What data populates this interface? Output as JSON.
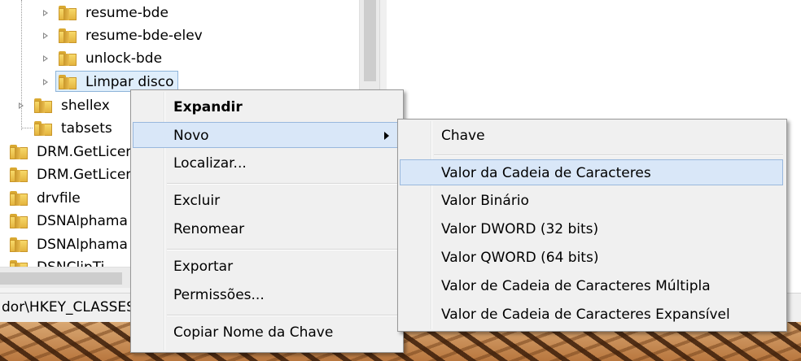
{
  "tree": {
    "items": [
      {
        "label": "resume-bde"
      },
      {
        "label": "resume-bde-elev"
      },
      {
        "label": "unlock-bde"
      },
      {
        "label": "Limpar disco"
      },
      {
        "label": "shellex"
      },
      {
        "label": "tabsets"
      },
      {
        "label": "DRM.GetLicen"
      },
      {
        "label": "DRM.GetLicen"
      },
      {
        "label": "drvfile"
      },
      {
        "label": "DSNAlphama"
      },
      {
        "label": "DSNAlphama"
      },
      {
        "label": "DSNClipTi"
      }
    ]
  },
  "statusbar": {
    "path": "dor\\HKEY_CLASSES"
  },
  "context_menu": {
    "items": [
      {
        "label": "Expandir"
      },
      {
        "label": "Novo"
      },
      {
        "label": "Localizar..."
      },
      {
        "label": "Excluir"
      },
      {
        "label": "Renomear"
      },
      {
        "label": "Exportar"
      },
      {
        "label": "Permissões..."
      },
      {
        "label": "Copiar Nome da Chave"
      }
    ]
  },
  "submenu": {
    "items": [
      {
        "label": "Chave"
      },
      {
        "label": "Valor da Cadeia de Caracteres"
      },
      {
        "label": "Valor Binário"
      },
      {
        "label": "Valor DWORD (32 bits)"
      },
      {
        "label": "Valor QWORD (64 bits)"
      },
      {
        "label": "Valor de Cadeia de Caracteres Múltipla"
      },
      {
        "label": "Valor de Cadeia de Caracteres Expansível"
      }
    ]
  },
  "icons": {
    "folder": "folder-icon",
    "expander": "expand-arrow-icon",
    "submenu_arrow": "submenu-arrow-icon"
  },
  "colors": {
    "highlight": "#d9e7f8",
    "highlight_border": "#99b8dd",
    "menu_bg": "#f0f0f0",
    "folder": "#e4b43e"
  }
}
